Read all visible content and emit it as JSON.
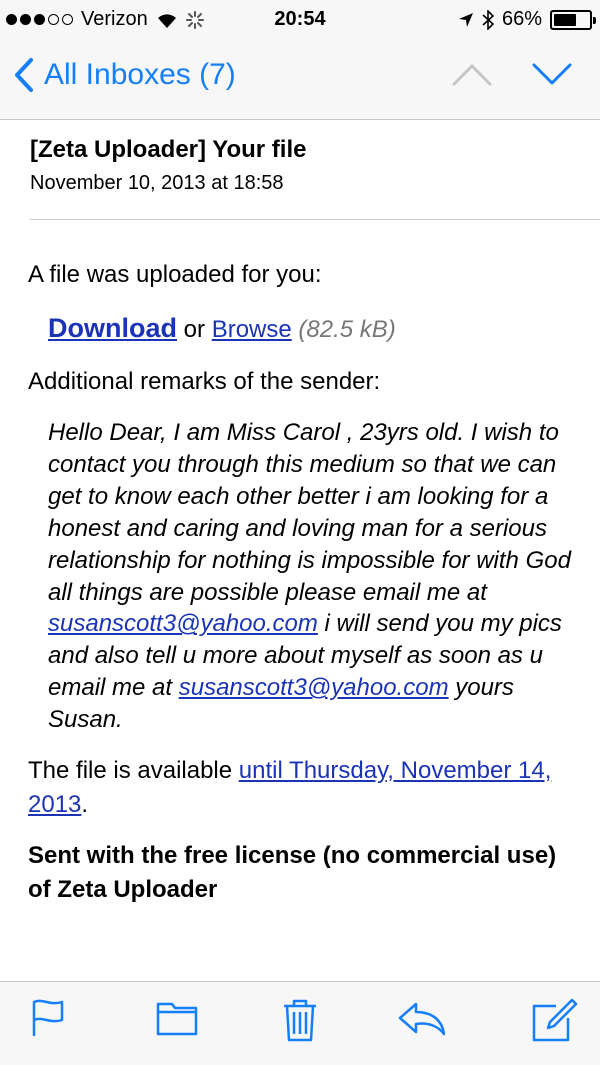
{
  "status_bar": {
    "carrier": "Verizon",
    "time": "20:54",
    "battery_label": "66%",
    "battery_level": 0.66
  },
  "nav": {
    "back_label": "All Inboxes (7)",
    "icons": [
      "chevron-left-icon",
      "chevron-up-icon",
      "chevron-down-icon"
    ]
  },
  "email": {
    "subject": "[Zeta Uploader] Your file",
    "date": "November 10, 2013 at 18:58",
    "intro": "A file was uploaded for you:",
    "download_label": "Download",
    "or_text": "or",
    "browse_label": "Browse",
    "file_size": "(82.5 kB)",
    "remarks_heading": "Additional remarks of the sender:",
    "remarks_part1": "Hello Dear, I am Miss Carol , 23yrs old. I wish to contact you through this medium so that we can get to know each other better i am looking for a honest and caring and loving man for a serious relationship for nothing is impossible for with God all things are possible please email me at ",
    "email_link": "susanscott3@yahoo.com",
    "remarks_part2": " i will send you my pics and also tell u more about myself as soon as u email me at ",
    "remarks_part3": " yours Susan.",
    "avail_prefix": "The file is available ",
    "avail_link": "until Thursday, November 14, 2013",
    "avail_suffix": ".",
    "sent_text": "Sent with the free license (no commercial use) of Zeta Uploader"
  },
  "toolbar": {
    "icons": [
      "flag-icon",
      "folder-icon",
      "trash-icon",
      "reply-icon",
      "compose-icon"
    ]
  },
  "colors": {
    "ios_blue": "#147efb",
    "link_blue": "#1b33b7",
    "bar_bg": "#f7f7f7"
  }
}
